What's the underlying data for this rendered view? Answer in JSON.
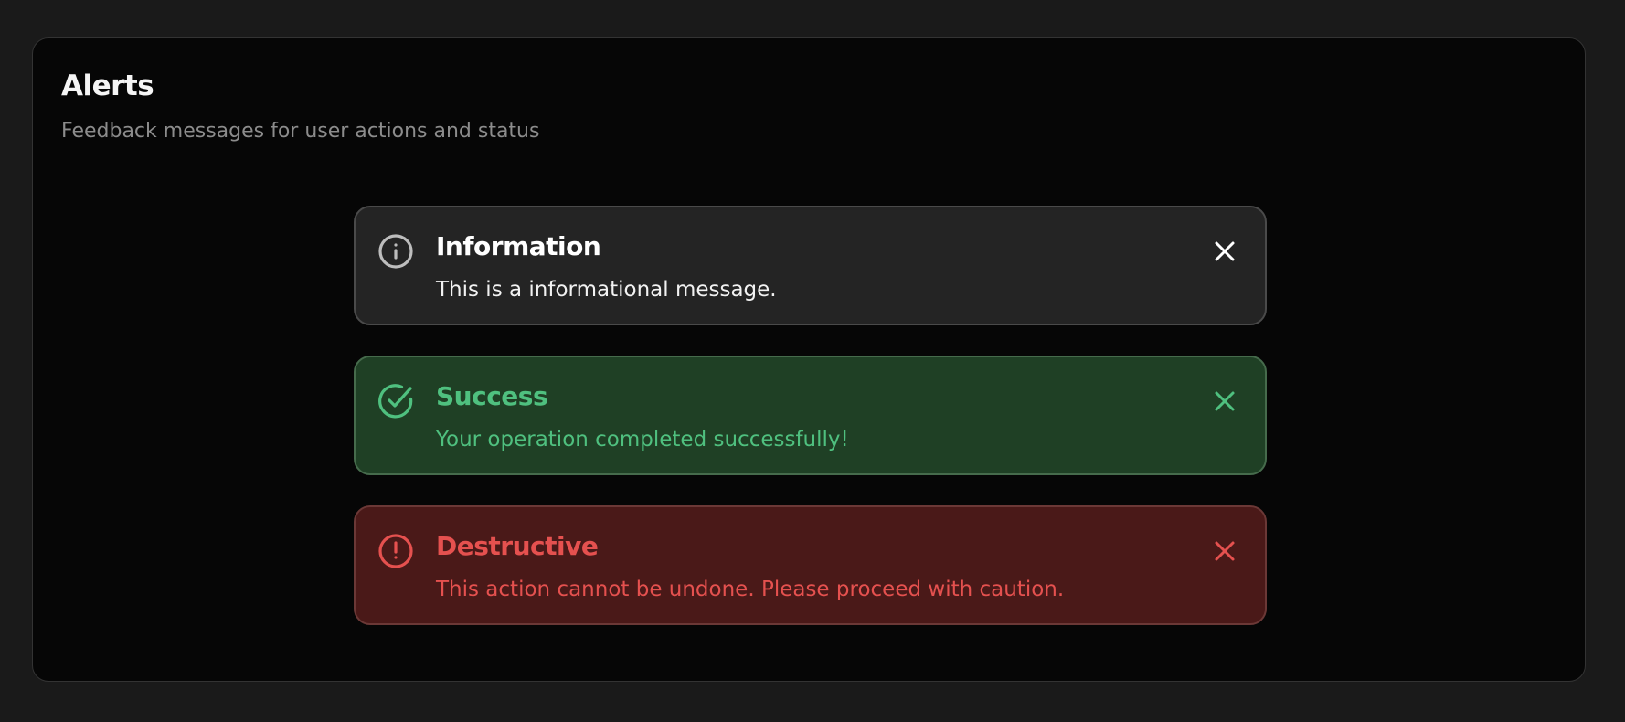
{
  "card": {
    "title": "Alerts",
    "subtitle": "Feedback messages for user actions and status"
  },
  "alerts": [
    {
      "variant": "information",
      "icon": "info-circle-icon",
      "title": "Information",
      "description": "This is a informational message.",
      "close_icon": "close-icon",
      "color": "#ffffff",
      "background": "#242424"
    },
    {
      "variant": "success",
      "icon": "check-circle-icon",
      "title": "Success",
      "description": "Your operation completed successfully!",
      "close_icon": "close-icon",
      "color": "#4fc07f",
      "background": "#1f4025"
    },
    {
      "variant": "destructive",
      "icon": "alert-circle-icon",
      "title": "Destructive",
      "description": "This action cannot be undone. Please proceed with caution.",
      "close_icon": "close-icon",
      "color": "#e5514f",
      "background": "#4a1918"
    }
  ]
}
